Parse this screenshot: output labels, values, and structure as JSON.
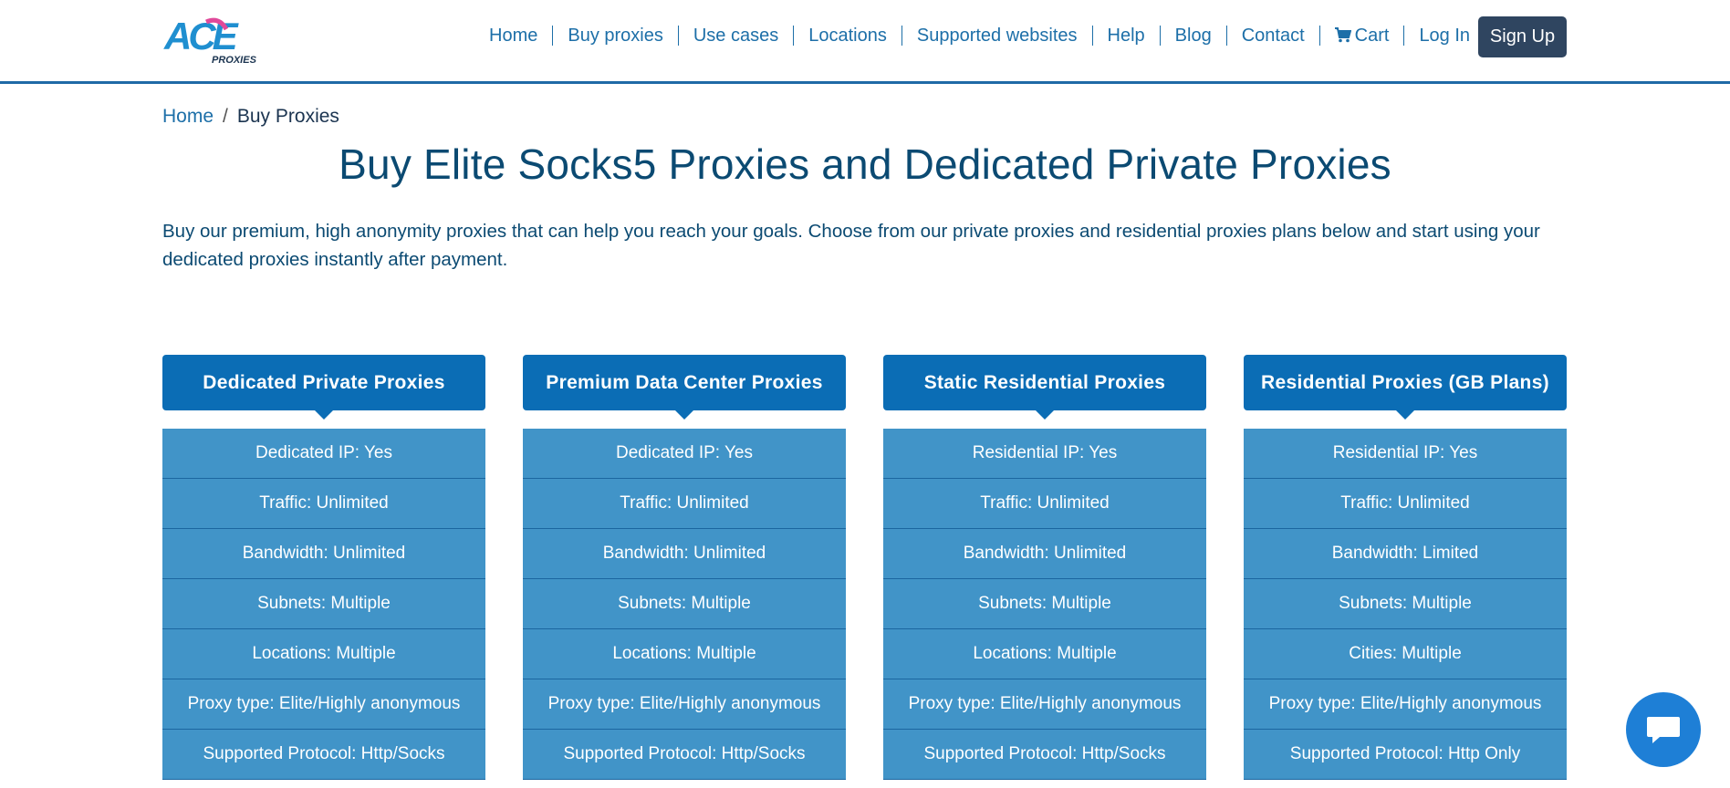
{
  "header": {
    "logo": {
      "main": "ACE",
      "sub": "PROXIES"
    },
    "nav": [
      "Home",
      "Buy proxies",
      "Use cases",
      "Locations",
      "Supported websites",
      "Help",
      "Blog",
      "Contact"
    ],
    "cart_label": "Cart",
    "login_label": "Log In",
    "signup_label": "Sign Up"
  },
  "breadcrumb": {
    "home": "Home",
    "separator": "/",
    "current": "Buy Proxies"
  },
  "page_title": "Buy Elite Socks5 Proxies and Dedicated Private Proxies",
  "intro": "Buy our premium, high anonymity proxies that can help you reach your goals. Choose from our private proxies and residential proxies plans below and start using your dedicated proxies instantly after payment.",
  "plans": [
    {
      "title": "Dedicated Private Proxies",
      "features": [
        "Dedicated IP: Yes",
        "Traffic: Unlimited",
        "Bandwidth: Unlimited",
        "Subnets: Multiple",
        "Locations: Multiple",
        "Proxy type: Elite/Highly anonymous",
        "Supported Protocol: Http/Socks"
      ]
    },
    {
      "title": "Premium Data Center Proxies",
      "features": [
        "Dedicated IP: Yes",
        "Traffic: Unlimited",
        "Bandwidth: Unlimited",
        "Subnets: Multiple",
        "Locations: Multiple",
        "Proxy type: Elite/Highly anonymous",
        "Supported Protocol: Http/Socks"
      ]
    },
    {
      "title": "Static Residential Proxies",
      "features": [
        "Residential IP: Yes",
        "Traffic: Unlimited",
        "Bandwidth: Unlimited",
        "Subnets: Multiple",
        "Locations: Multiple",
        "Proxy type: Elite/Highly anonymous",
        "Supported Protocol: Http/Socks"
      ]
    },
    {
      "title": "Residential Proxies (GB Plans)",
      "features": [
        "Residential IP: Yes",
        "Traffic: Unlimited",
        "Bandwidth: Limited",
        "Subnets: Multiple",
        "Cities: Multiple",
        "Proxy type: Elite/Highly anonymous",
        "Supported Protocol: Http Only"
      ]
    }
  ],
  "colors": {
    "primary": "#0b6db5",
    "feature_bg": "#4194c8",
    "title_text": "#0b4a72",
    "signup_bg": "#2f4560",
    "chat_bg": "#1e7fd6"
  },
  "icons": {
    "cart": "cart-icon",
    "chat": "chat-icon"
  }
}
